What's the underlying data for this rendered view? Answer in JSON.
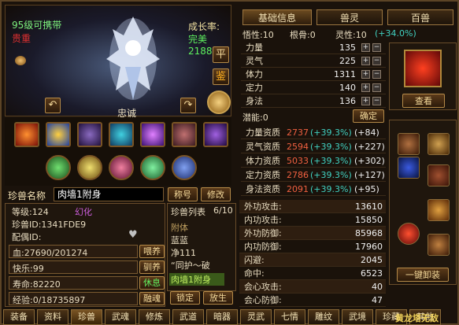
{
  "pet": {
    "level_line": "95级可携带",
    "quality": "贵重",
    "growth_label": "成长率:",
    "growth_value": "完美2188",
    "name": "忠诚",
    "btn_ping": "平",
    "btn_jian": "鉴"
  },
  "tabs": {
    "basic": "基础信息",
    "spirit": "兽灵",
    "beasts": "百兽"
  },
  "attrs": {
    "wuxing": "悟性:10",
    "gengu": "根骨:0",
    "lingxing": "灵性:10",
    "lingxing_pct": "(+34.0%)",
    "rows": [
      {
        "label": "力量",
        "value": "135"
      },
      {
        "label": "灵气",
        "value": "225"
      },
      {
        "label": "体力",
        "value": "1311"
      },
      {
        "label": "定力",
        "value": "140"
      },
      {
        "label": "身法",
        "value": "136"
      }
    ],
    "potential": "潜能:0",
    "confirm": "确定"
  },
  "aptitude": [
    {
      "label": "力量资质",
      "base": "2737",
      "pct": "(+39.3%)",
      "bonus": "(+84)"
    },
    {
      "label": "灵气资质",
      "base": "2594",
      "pct": "(+39.3%)",
      "bonus": "(+227)"
    },
    {
      "label": "体力资质",
      "base": "5033",
      "pct": "(+39.3%)",
      "bonus": "(+302)"
    },
    {
      "label": "定力资质",
      "base": "2786",
      "pct": "(+39.3%)",
      "bonus": "(+127)"
    },
    {
      "label": "身法资质",
      "base": "2091",
      "pct": "(+39.3%)",
      "bonus": "(+95)"
    }
  ],
  "combat": [
    {
      "label": "外功攻击:",
      "value": "13610"
    },
    {
      "label": "内功攻击:",
      "value": "15850"
    },
    {
      "label": "外功防御:",
      "value": "85968"
    },
    {
      "label": "内功防御:",
      "value": "17960"
    },
    {
      "label": "闪避:",
      "value": "2045"
    },
    {
      "label": "命中:",
      "value": "6523"
    },
    {
      "label": "会心攻击:",
      "value": "40"
    },
    {
      "label": "会心防御:",
      "value": "47"
    }
  ],
  "info": {
    "name_label": "珍兽名称",
    "name_value": "肉墙1附身",
    "rename": "称号",
    "modify": "修改",
    "level": "等级:124",
    "transform": "幻化",
    "pet_id": "珍兽ID:1341FDE9",
    "mate_id": "配偶ID:",
    "hp": "血:27690/201274",
    "happy": "快乐:99",
    "life": "寿命:82220",
    "exp": "经验:0/18735897",
    "feed": "喂养",
    "tame": "驯养",
    "rest": "休息",
    "fuse": "融魂"
  },
  "petlist": {
    "title": "珍兽列表",
    "count": "6/10",
    "items": [
      "附体",
      "蓝蓝",
      "净111",
      "“同护～破",
      "肉墙1附身"
    ],
    "lock": "锁定",
    "release": "放生"
  },
  "right": {
    "view": "查看",
    "unequip_all": "一键卸装"
  },
  "bottom_tabs": [
    "装备",
    "资料",
    "珍兽",
    "武魂",
    "修炼",
    "武道",
    "暗器",
    "灵武",
    "七情",
    "雕纹",
    "武境",
    "珍藏",
    "其他"
  ],
  "watermark": "黄龙塔无敌"
}
